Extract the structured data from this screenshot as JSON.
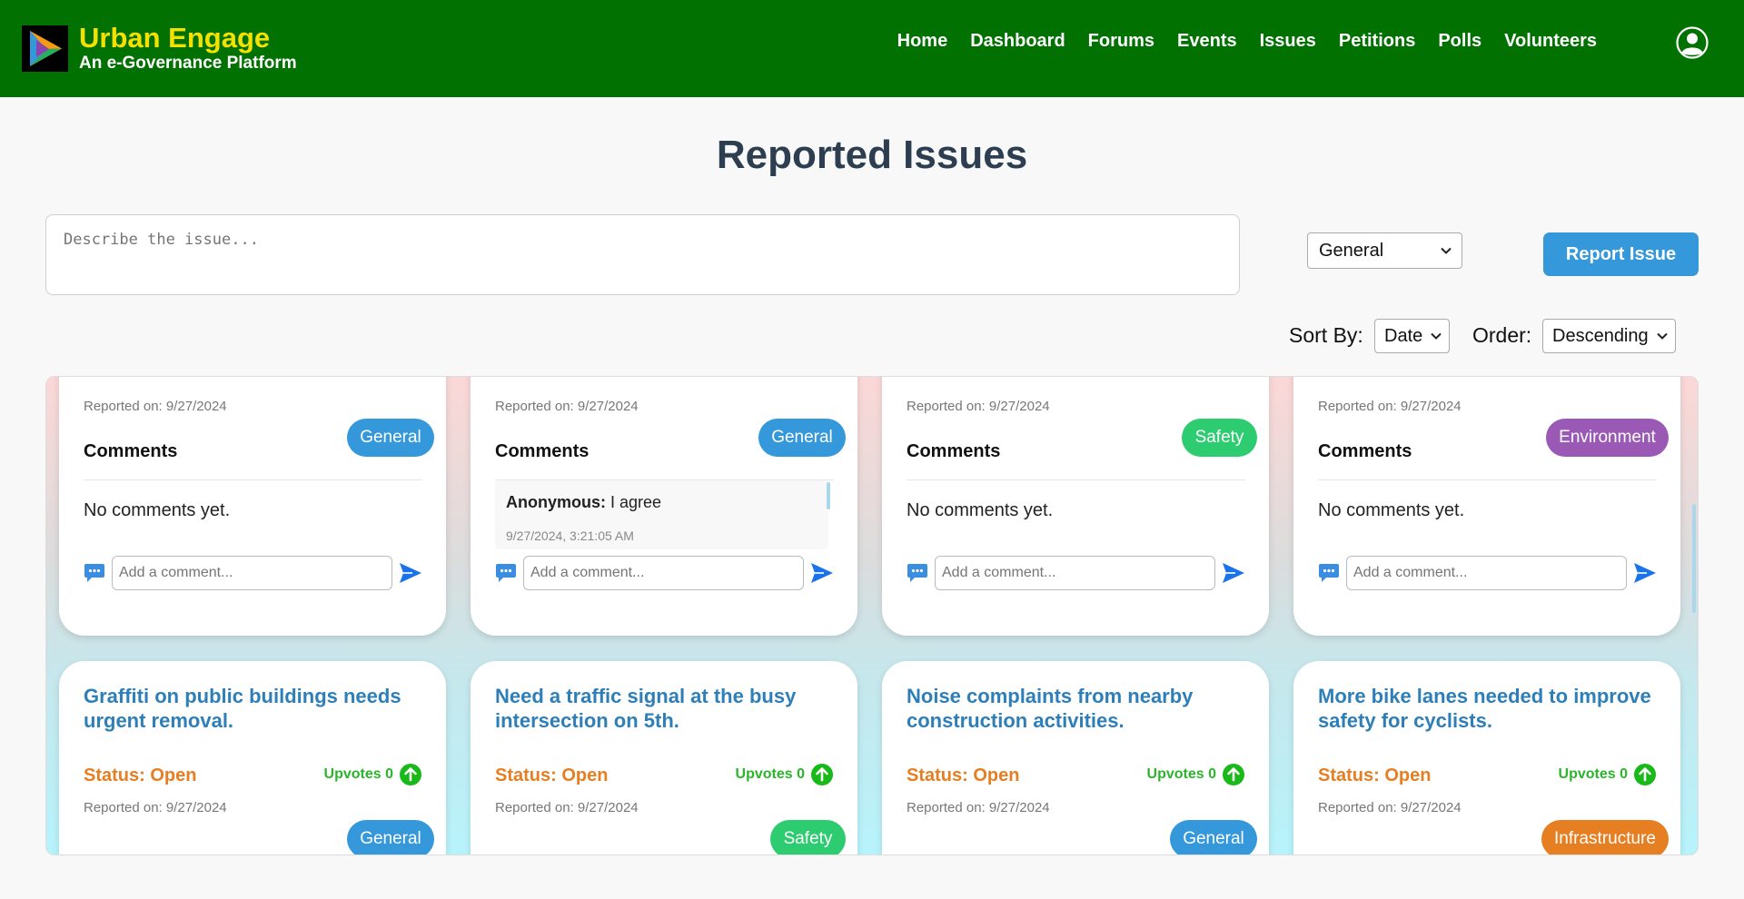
{
  "app": {
    "title": "Urban Engage",
    "subtitle": "An e-Governance Platform"
  },
  "nav": [
    {
      "label": "Home"
    },
    {
      "label": "Dashboard"
    },
    {
      "label": "Forums"
    },
    {
      "label": "Events"
    },
    {
      "label": "Issues"
    },
    {
      "label": "Petitions"
    },
    {
      "label": "Polls"
    },
    {
      "label": "Volunteers"
    }
  ],
  "page": {
    "title": "Reported Issues"
  },
  "report_form": {
    "placeholder": "Describe the issue...",
    "category_value": "General",
    "submit_label": "Report Issue"
  },
  "sorting": {
    "sort_label": "Sort By:",
    "sort_value": "Date",
    "order_label": "Order:",
    "order_value": "Descending"
  },
  "colors": {
    "header": "#017101",
    "brand_yellow": "#f6e000",
    "tag_general": "#3498db",
    "tag_safety": "#2ecc71",
    "tag_environment": "#9b59b6",
    "tag_infrastructure": "#e67e22",
    "status_open": "#e67e22",
    "upvote_green": "#2ab52a"
  },
  "issues_top": [
    {
      "date": "Reported on: 9/27/2024",
      "tag": "General",
      "comments_heading": "Comments",
      "no_comments": "No comments yet.",
      "comment_placeholder": "Add a comment..."
    },
    {
      "date": "Reported on: 9/27/2024",
      "tag": "General",
      "comments_heading": "Comments",
      "comment": {
        "author": "Anonymous:",
        "text": " I agree",
        "time": "9/27/2024, 3:21:05 AM"
      },
      "comment_placeholder": "Add a comment..."
    },
    {
      "date": "Reported on: 9/27/2024",
      "tag": "Safety",
      "comments_heading": "Comments",
      "no_comments": "No comments yet.",
      "comment_placeholder": "Add a comment..."
    },
    {
      "date": "Reported on: 9/27/2024",
      "tag": "Environment",
      "comments_heading": "Comments",
      "no_comments": "No comments yet.",
      "comment_placeholder": "Add a comment..."
    }
  ],
  "issues_bottom": [
    {
      "title": "Graffiti on public buildings needs urgent removal.",
      "status": "Status: Open",
      "upvotes": "Upvotes 0",
      "date": "Reported on: 9/27/2024",
      "tag": "General"
    },
    {
      "title": "Need a traffic signal at the busy intersection on 5th.",
      "status": "Status: Open",
      "upvotes": "Upvotes 0",
      "date": "Reported on: 9/27/2024",
      "tag": "Safety"
    },
    {
      "title": "Noise complaints from nearby construction activities.",
      "status": "Status: Open",
      "upvotes": "Upvotes 0",
      "date": "Reported on: 9/27/2024",
      "tag": "General"
    },
    {
      "title": "More bike lanes needed to improve safety for cyclists.",
      "status": "Status: Open",
      "upvotes": "Upvotes 0",
      "date": "Reported on: 9/27/2024",
      "tag": "Infrastructure"
    }
  ]
}
